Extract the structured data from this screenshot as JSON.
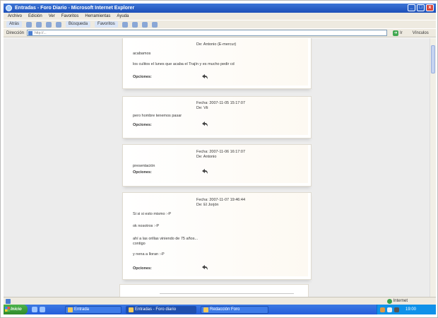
{
  "window": {
    "title": "Entradas - Foro Diario - Microsoft Internet Explorer",
    "controls": [
      "_",
      "□",
      "x"
    ]
  },
  "menubar": [
    "Archivo",
    "Edición",
    "Ver",
    "Favoritos",
    "Herramientas",
    "Ayuda"
  ],
  "toolbar": {
    "back": "Atrás",
    "search": "Búsqueda",
    "favorites": "Favoritos"
  },
  "addressbar": {
    "label": "Dirección",
    "url": "http://...",
    "go": "Ir",
    "links": "Vínculos"
  },
  "posts": [
    {
      "meta_lines": [
        "De: Antonio (E-mercur)"
      ],
      "body": [
        "acabamos",
        "los culitos el lunes que acaba el Trajín y es mucho pedir cd"
      ],
      "options_label": "Opciones:"
    },
    {
      "meta_lines": [
        "Fecha: 2007-11-05 15:17:07",
        "De: Vti"
      ],
      "body": [
        "pero hombre tenemos pasar"
      ],
      "options_label": "Opciones:"
    },
    {
      "meta_lines": [
        "Fecha: 2007-11-06 16:17:07",
        "De: Antonio"
      ],
      "body": [
        "presentación"
      ],
      "options_label": "Opciones:"
    },
    {
      "meta_lines": [
        "Fecha: 2007-11-07 19:46:44",
        "De: El Jorjón"
      ],
      "body": [
        "Si si si esto mismo  :-P",
        "ok nosotros  :-P",
        "ahí a las orillas viniendo de 75 años...",
        "contigo",
        "y nena a lloran  :-P"
      ],
      "options_label": "Opciones:"
    }
  ],
  "statusbar": {
    "zone": "Internet"
  },
  "taskbar": {
    "start": "Inicio",
    "tasks": [
      "Entrada",
      "Entradas - Foro diario",
      "Redacción Foro"
    ],
    "clock": "19:00"
  }
}
